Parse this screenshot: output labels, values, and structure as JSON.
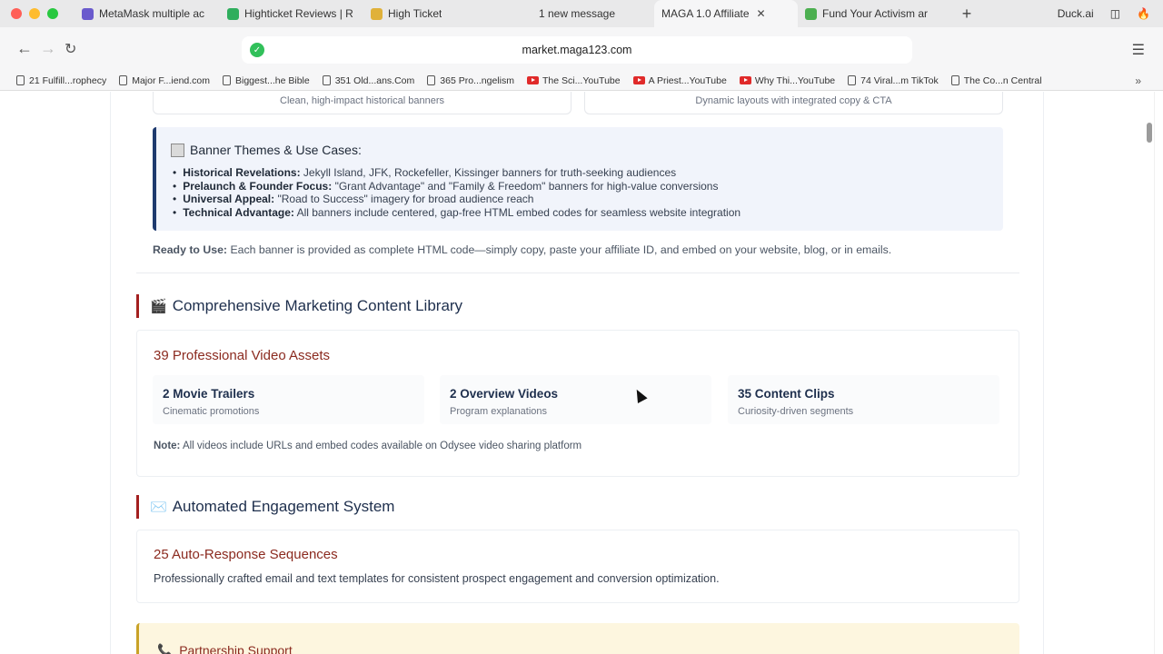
{
  "browser": {
    "tabs": [
      {
        "label": "MetaMask multiple ac",
        "fav_color": "#6a5acd",
        "active": false
      },
      {
        "label": "Highticket Reviews | R",
        "fav_color": "#2fae5d",
        "active": false
      },
      {
        "label": "High Ticket",
        "fav_color": "#e0b13a",
        "active": false
      },
      {
        "label": "1 new message",
        "fav_color": "",
        "active": false
      },
      {
        "label": "MAGA 1.0 Affiliate",
        "fav_color": "",
        "active": true
      },
      {
        "label": "Fund Your Activism ar",
        "fav_color": "#4caf50",
        "active": false
      }
    ],
    "new_tab_symbol": "+",
    "brand_label": "Duck.ai",
    "url": "market.maga123.com",
    "bookmarks": [
      {
        "label": "21 Fulfill...rophecy",
        "type": "bookmark"
      },
      {
        "label": "Major F...iend.com",
        "type": "bookmark"
      },
      {
        "label": "Biggest...he Bible",
        "type": "bookmark"
      },
      {
        "label": "351 Old...ans.Com",
        "type": "bookmark"
      },
      {
        "label": "365 Pro...ngelism",
        "type": "bookmark"
      },
      {
        "label": "The Sci...YouTube",
        "type": "youtube"
      },
      {
        "label": "A Priest...YouTube",
        "type": "youtube"
      },
      {
        "label": "Why Thi...YouTube",
        "type": "youtube"
      },
      {
        "label": "74 Viral...m TikTok",
        "type": "bookmark"
      },
      {
        "label": "The Co...n Central",
        "type": "bookmark"
      }
    ]
  },
  "banners": {
    "cards": [
      "Clean, high-impact historical banners",
      "Dynamic layouts with integrated copy & CTA"
    ],
    "themes_title": "Banner Themes & Use Cases:",
    "themes": [
      {
        "label": "Historical Revelations:",
        "text": "Jekyll Island, JFK, Rockefeller, Kissinger banners for truth-seeking audiences"
      },
      {
        "label": "Prelaunch & Founder Focus:",
        "text": "\"Grant Advantage\" and \"Family & Freedom\" banners for high-value conversions"
      },
      {
        "label": "Universal Appeal:",
        "text": "\"Road to Success\" imagery for broad audience reach"
      },
      {
        "label": "Technical Advantage:",
        "text": "All banners include centered, gap-free HTML embed codes for seamless website integration"
      }
    ],
    "ready_label": "Ready to Use:",
    "ready_text": "Each banner is provided as complete HTML code—simply copy, paste your affiliate ID, and embed on your website, blog, or in emails."
  },
  "content_library": {
    "icon": "🎬",
    "title": "Comprehensive Marketing Content Library",
    "subtitle": "39 Professional Video Assets",
    "stats": [
      {
        "title": "2 Movie Trailers",
        "desc": "Cinematic promotions"
      },
      {
        "title": "2 Overview Videos",
        "desc": "Program explanations"
      },
      {
        "title": "35 Content Clips",
        "desc": "Curiosity-driven segments"
      }
    ],
    "note_label": "Note:",
    "note_text": "All videos include URLs and embed codes available on Odysee video sharing platform"
  },
  "engagement": {
    "icon": "✉️",
    "title": "Automated Engagement System",
    "subtitle": "25 Auto-Response Sequences",
    "text": "Professionally crafted email and text templates for consistent prospect engagement and conversion optimization."
  },
  "partnership": {
    "icon": "📞",
    "title": "Partnership Support"
  },
  "colors": {
    "accent_red": "#a32020",
    "navy": "#1e2f4d",
    "theme_bg": "#f1f4fb"
  }
}
